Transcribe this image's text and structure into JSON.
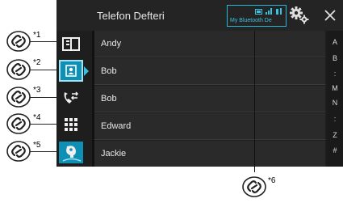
{
  "header": {
    "title": "Telefon Defteri",
    "bt_device": "My Bluetooth De"
  },
  "contacts": [
    "Andy",
    "Bob",
    "Bob",
    "Edward",
    "Jackie"
  ],
  "index": [
    "A",
    "B",
    ":",
    "M",
    "N",
    ":",
    "Z",
    "#"
  ],
  "callouts": [
    "*1",
    "*2",
    "*3",
    "*4",
    "*5",
    "*6"
  ],
  "sidebar": {
    "icons": [
      "phone-book-icon",
      "contacts-icon",
      "call-history-icon",
      "keypad-icon",
      "voice-recognition-icon"
    ],
    "selected": 1
  },
  "colors": {
    "accent": "#25b8d8",
    "selected": "#0f8fb4"
  }
}
